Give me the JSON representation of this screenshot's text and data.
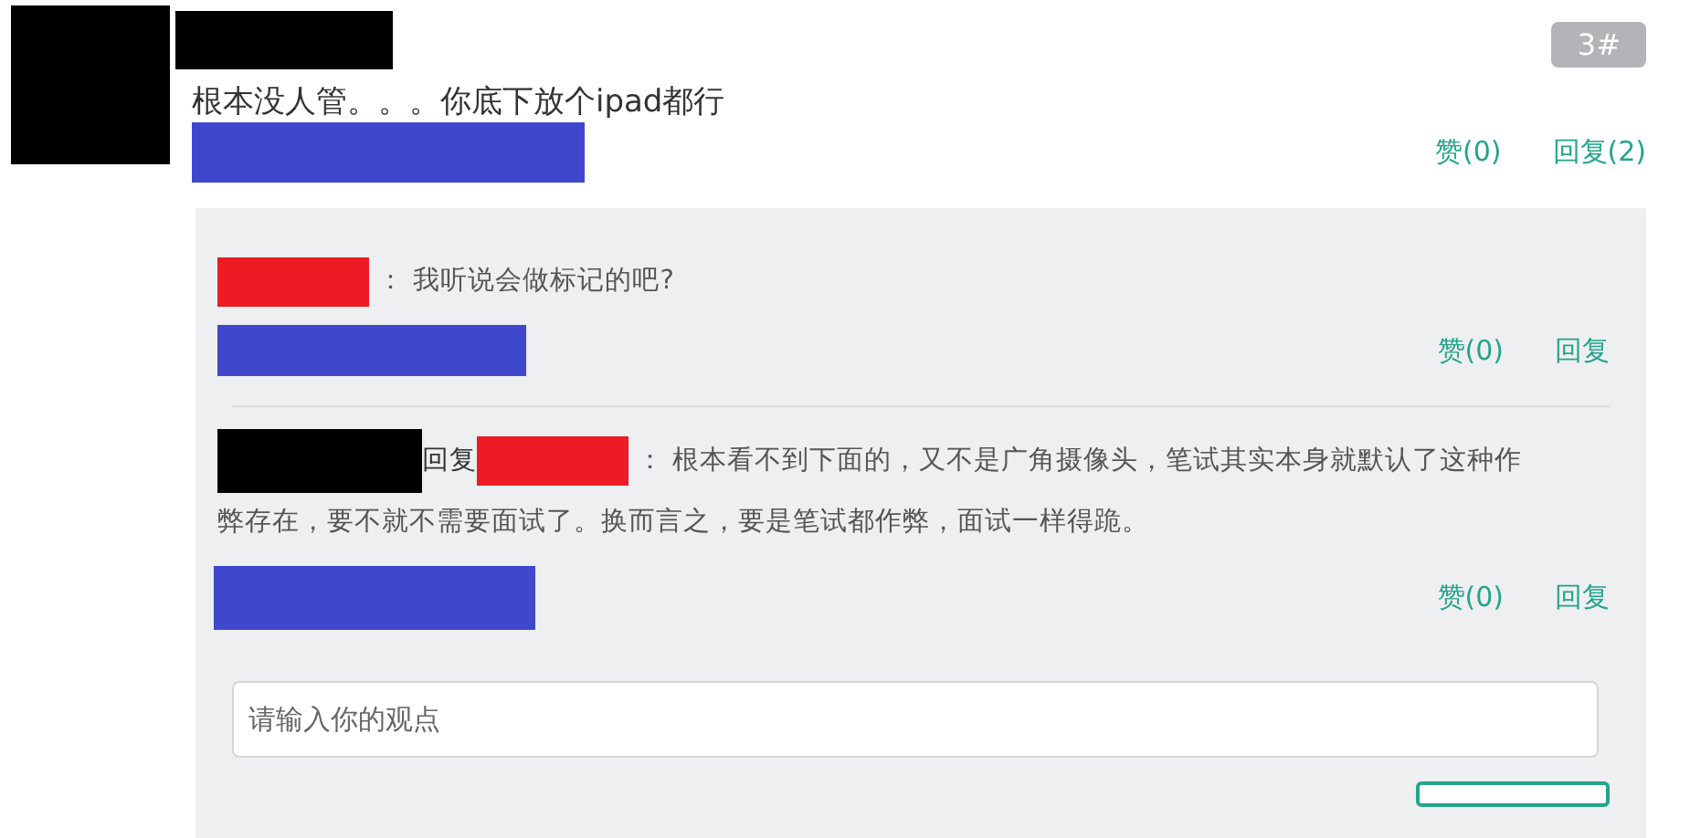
{
  "post": {
    "floor": "3#",
    "text": "根本没人管。。。你底下放个ipad都行",
    "like": "赞(0)",
    "reply": "回复(2)"
  },
  "replies": [
    {
      "kind": "comment",
      "lines": [
        "：  我听说会做标记的吧?"
      ],
      "like": "赞(0)",
      "reply": "回复"
    },
    {
      "kind": "reply",
      "reply_word": "回复",
      "lines": [
        "：  根本看不到下面的，又不是广角摄像头，笔试其实本身就默认了这种作",
        "弊存在，要不就不需要面试了。换而言之，要是笔试都作弊，面试一样得跪。"
      ],
      "like": "赞(0)",
      "reply": "回复"
    }
  ],
  "input": {
    "placeholder": "请输入你的观点"
  }
}
